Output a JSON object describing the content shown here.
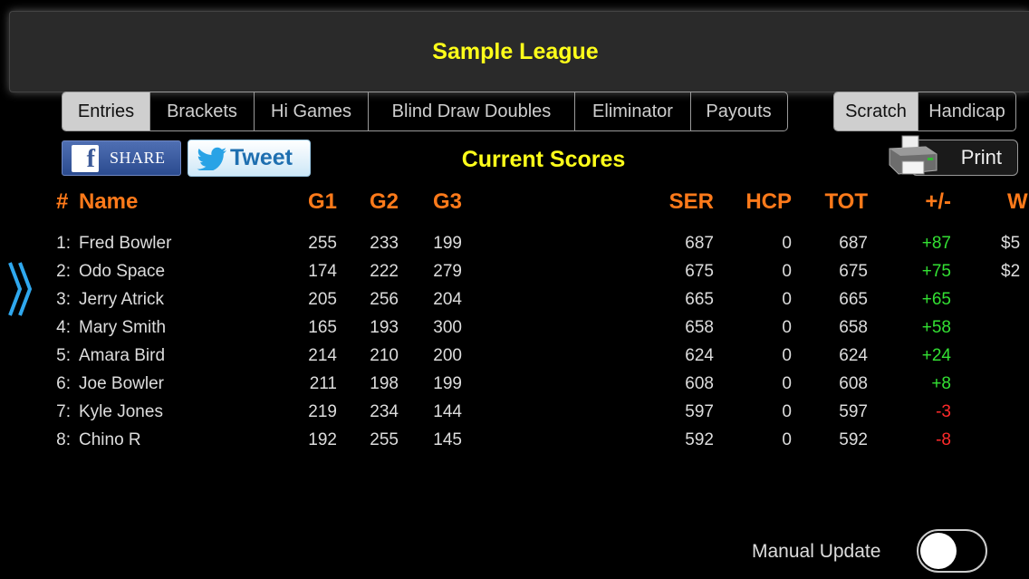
{
  "league": {
    "title": "Sample League"
  },
  "tabs": [
    {
      "label": "Entries",
      "selected": true
    },
    {
      "label": "Brackets",
      "selected": false
    },
    {
      "label": "Hi Games",
      "selected": false
    },
    {
      "label": "Blind Draw Doubles",
      "selected": false
    },
    {
      "label": "Eliminator",
      "selected": false
    },
    {
      "label": "Payouts",
      "selected": false
    }
  ],
  "scoring_mode": [
    {
      "label": "Scratch",
      "selected": true
    },
    {
      "label": "Handicap",
      "selected": false
    }
  ],
  "social": {
    "share_label": "SHARE",
    "fb_letter": "f",
    "tweet_label": "Tweet"
  },
  "section_title": "Current Scores",
  "print_label": "Print",
  "columns": {
    "rank": "#",
    "name": "Name",
    "g1": "G1",
    "g2": "G2",
    "g3": "G3",
    "ser": "SER",
    "hcp": "HCP",
    "tot": "TOT",
    "diff": "+/-",
    "win": "W"
  },
  "rows": [
    {
      "rank": "1:",
      "name": "Fred Bowler",
      "g1": "255",
      "g2": "233",
      "g3": "199",
      "ser": "687",
      "hcp": "0",
      "tot": "687",
      "diff": "+87",
      "win": "$5"
    },
    {
      "rank": "2:",
      "name": "Odo Space",
      "g1": "174",
      "g2": "222",
      "g3": "279",
      "ser": "675",
      "hcp": "0",
      "tot": "675",
      "diff": "+75",
      "win": "$2"
    },
    {
      "rank": "3:",
      "name": "Jerry Atrick",
      "g1": "205",
      "g2": "256",
      "g3": "204",
      "ser": "665",
      "hcp": "0",
      "tot": "665",
      "diff": "+65",
      "win": ""
    },
    {
      "rank": "4:",
      "name": "Mary Smith",
      "g1": "165",
      "g2": "193",
      "g3": "300",
      "ser": "658",
      "hcp": "0",
      "tot": "658",
      "diff": "+58",
      "win": ""
    },
    {
      "rank": "5:",
      "name": "Amara Bird",
      "g1": "214",
      "g2": "210",
      "g3": "200",
      "ser": "624",
      "hcp": "0",
      "tot": "624",
      "diff": "+24",
      "win": ""
    },
    {
      "rank": "6:",
      "name": "Joe Bowler",
      "g1": "211",
      "g2": "198",
      "g3": "199",
      "ser": "608",
      "hcp": "0",
      "tot": "608",
      "diff": "+8",
      "win": ""
    },
    {
      "rank": "7:",
      "name": "Kyle Jones",
      "g1": "219",
      "g2": "234",
      "g3": "144",
      "ser": "597",
      "hcp": "0",
      "tot": "597",
      "diff": "-3",
      "win": ""
    },
    {
      "rank": "8:",
      "name": "Chino R",
      "g1": "192",
      "g2": "255",
      "g3": "145",
      "ser": "592",
      "hcp": "0",
      "tot": "592",
      "diff": "-8",
      "win": ""
    }
  ],
  "manual_update": {
    "label": "Manual Update",
    "on": false
  },
  "icons": {
    "expand": "double-chevron-right-icon",
    "printer": "printer-icon",
    "bird": "bird-icon"
  },
  "colors": {
    "title_yellow": "#ffff1a",
    "header_orange": "#ff7a1a",
    "positive": "#33e033",
    "negative": "#ff2a2a"
  }
}
